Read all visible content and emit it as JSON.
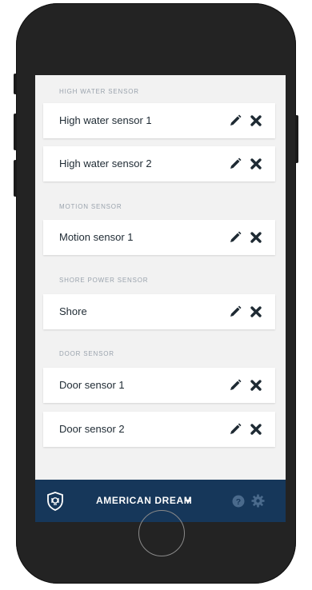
{
  "sections": [
    {
      "header": "HIGH WATER SENSOR",
      "items": [
        {
          "label": "High water sensor 1"
        },
        {
          "label": "High water sensor 2"
        }
      ]
    },
    {
      "header": "MOTION SENSOR",
      "items": [
        {
          "label": "Motion sensor 1"
        }
      ]
    },
    {
      "header": "SHORE POWER SENSOR",
      "items": [
        {
          "label": "Shore"
        }
      ]
    },
    {
      "header": "DOOR SENSOR",
      "items": [
        {
          "label": "Door sensor 1"
        },
        {
          "label": "Door sensor 2"
        }
      ]
    }
  ],
  "bottom_bar": {
    "title": "AMERICAN DREAM",
    "logo_icon": "shield-icon",
    "dropdown_icon": "caret-down-icon",
    "help_icon": "help-icon",
    "settings_icon": "gear-icon"
  },
  "row_icons": {
    "edit": "pencil-icon",
    "delete": "close-icon"
  },
  "colors": {
    "brand_navy": "#16375a",
    "screen_bg": "#f2f2f2",
    "header_text": "#9aa3ad",
    "icon_dark": "#1e2a33",
    "bar_icon_muted": "#4a6a8c"
  }
}
